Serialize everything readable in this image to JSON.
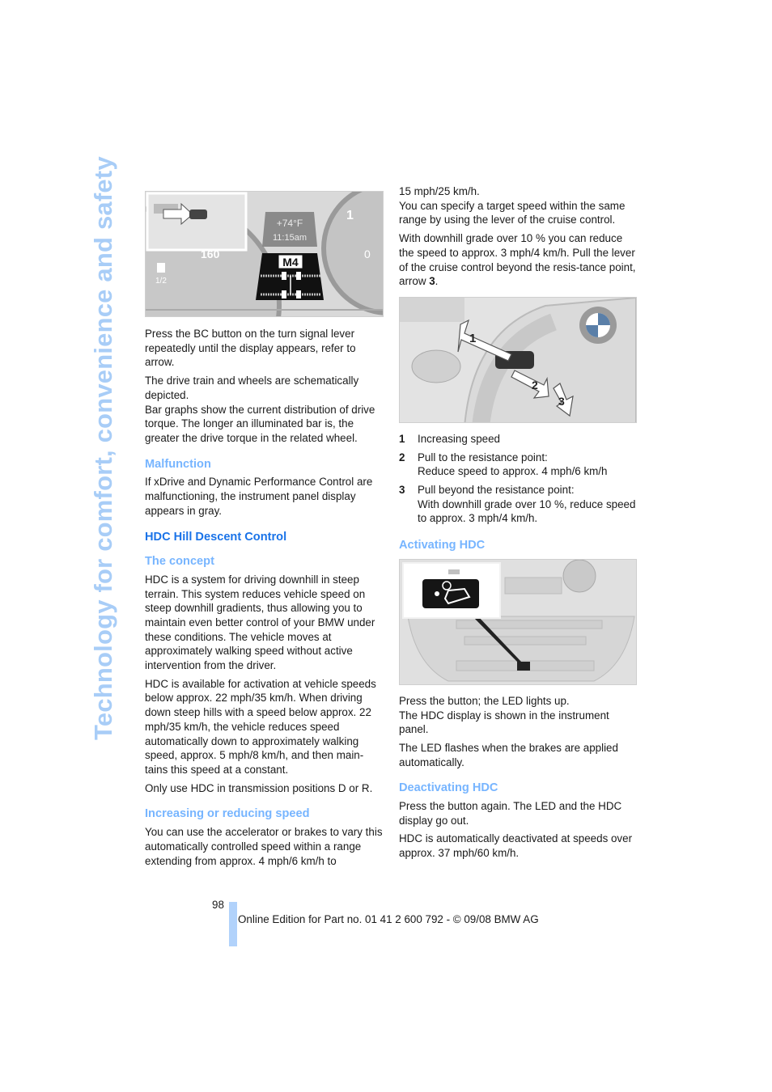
{
  "side_title": "Technology for comfort, convenience and safety",
  "left_column": {
    "figure1": {
      "display_temp": "+74°F",
      "display_time": "11:15am",
      "gear": "M4",
      "gauge_labels": [
        "160",
        "1/2",
        "1",
        "0"
      ]
    },
    "p1": "Press the BC button on the turn signal lever repeatedly until the display appears, refer to arrow.",
    "p2a": "The drive train and wheels are schematically depicted.",
    "p2b": "Bar graphs show the current distribution of drive torque. The longer an illuminated bar is, the greater the drive torque in the related wheel.",
    "malfunction_heading": "Malfunction",
    "malfunction_text": "If xDrive and Dynamic Performance Control are malfunctioning, the instrument panel display appears in gray.",
    "hdc_heading": "HDC Hill Descent Control",
    "concept_heading": "The concept",
    "concept_p1": "HDC is a system for driving downhill in steep terrain. This system reduces vehicle speed on steep downhill gradients, thus allowing you to maintain even better control of your BMW under these conditions. The vehicle moves at approximately walking speed without active intervention from the driver.",
    "concept_p2": "HDC is available for activation at vehicle speeds below approx. 22 mph/35 km/h. When driving down steep hills with a speed below approx. 22 mph/35 km/h, the vehicle reduces speed automatically down to approximately walking speed, approx. 5 mph/8 km/h, and then main-tains this speed at a constant.",
    "concept_p3": "Only use HDC in transmission positions D or R.",
    "speed_heading": "Increasing or reducing speed",
    "speed_p1": "You can use the accelerator or brakes to vary this automatically controlled speed within a range extending from approx. 4 mph/6 km/h to"
  },
  "right_column": {
    "p_cont": "15 mph/25 km/h.",
    "p_cont2": "You can specify a target speed within the same range by using the lever of the cruise control.",
    "p_grade_pre": "With downhill grade over 10 % you can reduce the speed to approx. 3 mph/4 km/h. Pull the lever of the cruise control beyond the resis-tance point, arrow ",
    "p_grade_bold": "3",
    "p_grade_end": ".",
    "figure2_arrows": [
      "1",
      "2",
      "3"
    ],
    "list": [
      {
        "num": "1",
        "line1": "Increasing speed",
        "line2": ""
      },
      {
        "num": "2",
        "line1": "Pull to the resistance point:",
        "line2": "Reduce speed to approx. 4 mph/6 km/h"
      },
      {
        "num": "3",
        "line1": "Pull beyond the resistance point:",
        "line2": "With downhill grade over 10 %, reduce speed to approx. 3 mph/4 km/h."
      }
    ],
    "activating_heading": "Activating HDC",
    "activating_p1a": "Press the button; the LED lights up.",
    "activating_p1b": "The HDC display is shown in the instrument panel.",
    "activating_p2": "The LED flashes when the brakes are applied automatically.",
    "deactivating_heading": "Deactivating HDC",
    "deactivating_p1": "Press the button again. The LED and the HDC display go out.",
    "deactivating_p2": "HDC is automatically deactivated at speeds over approx. 37 mph/60 km/h."
  },
  "footer": {
    "page_number": "98",
    "edition_text": "Online Edition for Part no. 01 41 2 600 792 - © 09/08 BMW AG"
  }
}
